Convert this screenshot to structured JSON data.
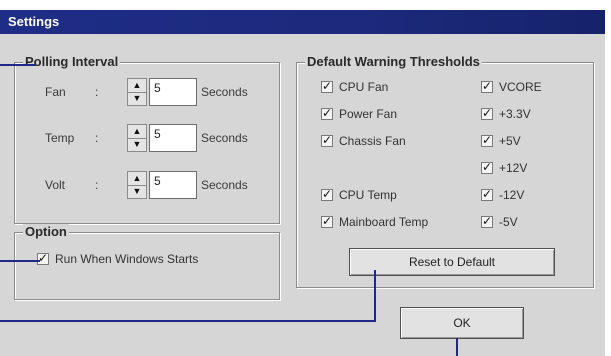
{
  "window": {
    "title": "Settings"
  },
  "polling": {
    "legend": "Polling Interval",
    "rows": [
      {
        "label": "Fan",
        "value": "5",
        "unit": "Seconds"
      },
      {
        "label": "Temp",
        "value": "5",
        "unit": "Seconds"
      },
      {
        "label": "Volt",
        "value": "5",
        "unit": "Seconds"
      }
    ],
    "colon": ":"
  },
  "option": {
    "legend": "Option",
    "run_label": "Run When Windows Starts"
  },
  "thresholds": {
    "legend": "Default Warning Thresholds",
    "left": [
      "CPU Fan",
      "Power Fan",
      "Chassis Fan",
      "CPU Temp",
      "Mainboard Temp"
    ],
    "right": [
      "VCORE",
      "+3.3V",
      "+5V",
      "+12V",
      "-12V",
      "-5V"
    ],
    "reset_label": "Reset to Default"
  },
  "footer": {
    "ok_label": "OK"
  },
  "icons": {
    "check": "checkmark-icon",
    "spin_up": "arrow-up-icon",
    "spin_down": "arrow-down-icon"
  },
  "colors": {
    "title_bar": "#1e2d86",
    "dialog_bg": "#d6d6d6",
    "leader": "#1d2a86"
  }
}
